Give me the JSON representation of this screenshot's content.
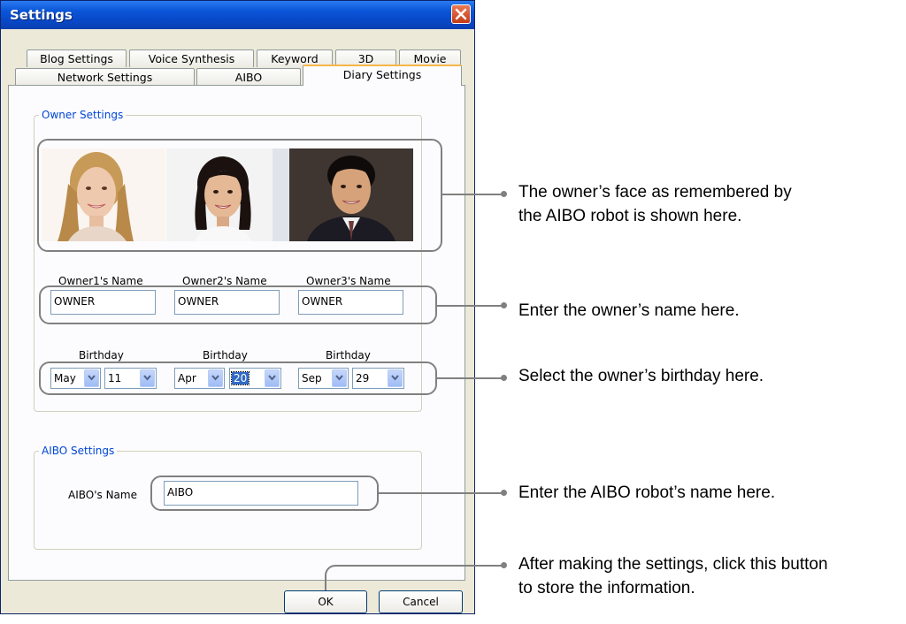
{
  "window": {
    "title": "Settings"
  },
  "tabs": {
    "row1": [
      "Blog Settings",
      "Voice Synthesis",
      "Keyword",
      "3D",
      "Movie"
    ],
    "row2": [
      "Network Settings",
      "AIBO",
      "Diary Settings"
    ],
    "active": "Diary Settings"
  },
  "owner_settings": {
    "label": "Owner Settings",
    "owners": [
      {
        "name_label": "Owner1's Name",
        "name": "OWNER",
        "birthday_label": "Birthday",
        "month": "May",
        "day": "11"
      },
      {
        "name_label": "Owner2's Name",
        "name": "OWNER",
        "birthday_label": "Birthday",
        "month": "Apr",
        "day": "20"
      },
      {
        "name_label": "Owner3's Name",
        "name": "OWNER",
        "birthday_label": "Birthday",
        "month": "Sep",
        "day": "29"
      }
    ]
  },
  "aibo_settings": {
    "label": "AIBO Settings",
    "name_label": "AIBO's Name",
    "name": "AIBO"
  },
  "buttons": {
    "ok": "OK",
    "cancel": "Cancel"
  },
  "annotations": {
    "face_line1": "The owner’s face as remembered by",
    "face_line2": "the AIBO robot is shown here.",
    "name": "Enter the owner’s name here.",
    "birthday": "Select the owner’s birthday here.",
    "aibo": "Enter the AIBO robot’s name here.",
    "button_line1": "After making the settings, click this button",
    "button_line2": "to store the information."
  },
  "colors": {
    "title_bar": "#0a56d8",
    "group_label": "#0046d5",
    "callout": "#808080",
    "active_tab_accent": "#f7b64a"
  },
  "icons": {
    "close": "close-icon",
    "dropdown": "chevron-down-icon"
  }
}
